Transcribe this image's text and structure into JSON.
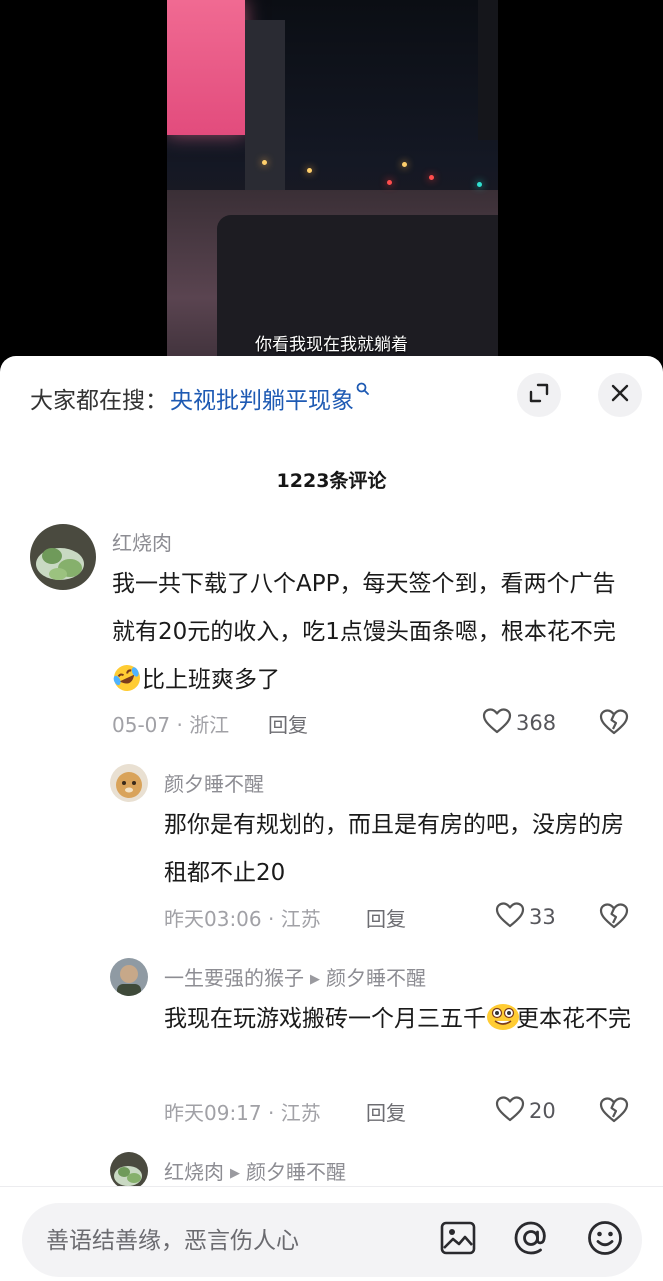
{
  "video": {
    "subtitle": "你看我现在我就躺着"
  },
  "sheet": {
    "search_prefix": "大家都在搜：",
    "search_term": "央视批判躺平现象",
    "comment_count_title": "1223条评论"
  },
  "comments": [
    {
      "author": "红烧肉",
      "text": "我一共下载了八个APP，每天签个到，看两个广告就有20元的收入，吃1点馒头面条嗯，根本花不完",
      "text_after_emoji": "比上班爽多了",
      "emoji": "rofl-emoji",
      "date_location": "05-07 · 浙江",
      "reply_label": "回复",
      "likes": "368"
    },
    {
      "author": "颜夕睡不醒",
      "text": "那你是有规划的，而且是有房的吧，没房的房租都不止20",
      "date_location": "昨天03:06 · 江苏",
      "reply_label": "回复",
      "likes": "33"
    },
    {
      "author": "一生要强的猴子",
      "reply_to": "颜夕睡不醒",
      "text": "我现在玩游戏搬砖一个月三五千",
      "text_after_emoji": "更本花不完",
      "emoji": "goofy-emoji",
      "date_location": "昨天09:17 · 江苏",
      "reply_label": "回复",
      "likes": "20"
    },
    {
      "author": "红烧肉",
      "reply_to": "颜夕睡不醒"
    }
  ],
  "input_bar": {
    "placeholder": "善语结善缘，恶言伤人心"
  },
  "colors": {
    "link_blue": "#1e5ab3",
    "meta_gray": "#a1a1a6",
    "background": "#ffffff"
  }
}
